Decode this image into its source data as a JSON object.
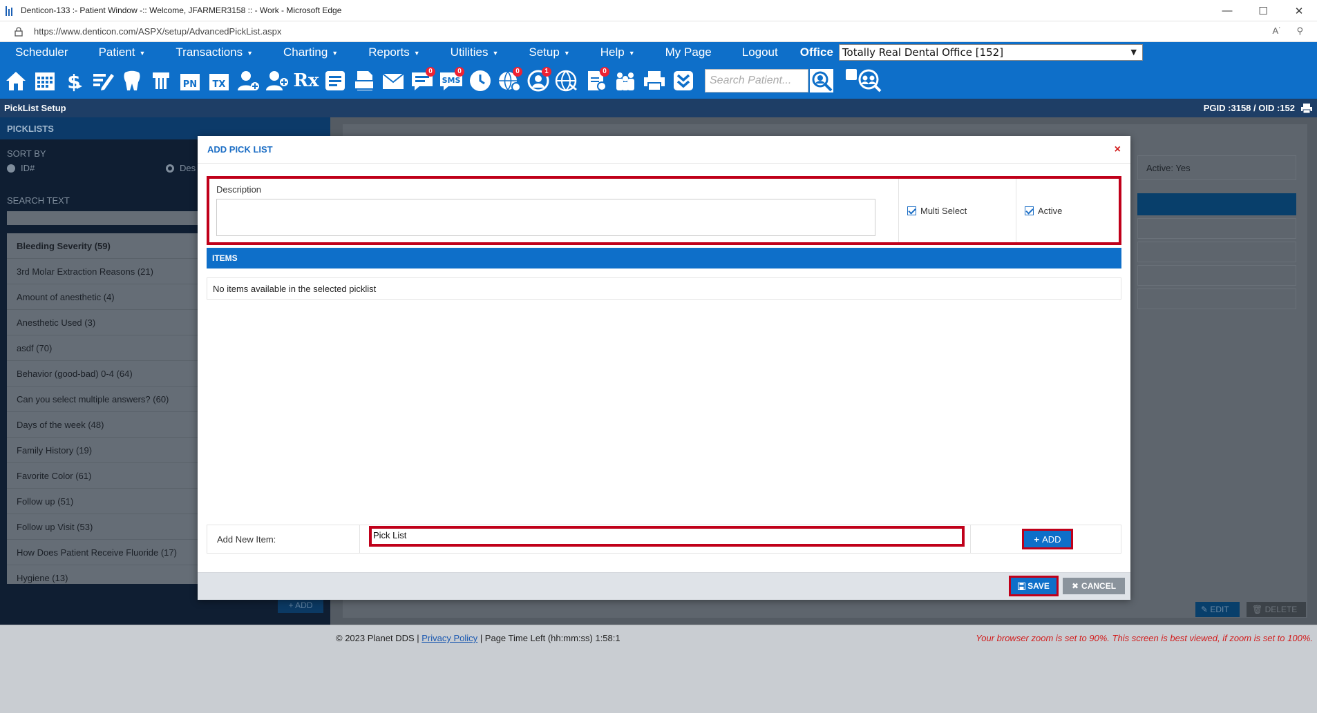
{
  "window": {
    "title": "Denticon-133 :- Patient Window -:: Welcome, JFARMER3158 :: - Work - Microsoft Edge",
    "url": "https://www.denticon.com/ASPX/setup/AdvancedPickList.aspx"
  },
  "menu": {
    "items": [
      {
        "label": "Scheduler",
        "caret": false
      },
      {
        "label": "Patient",
        "caret": true
      },
      {
        "label": "Transactions",
        "caret": true
      },
      {
        "label": "Charting",
        "caret": true
      },
      {
        "label": "Reports",
        "caret": true
      },
      {
        "label": "Utilities",
        "caret": true
      },
      {
        "label": "Setup",
        "caret": true
      },
      {
        "label": "Help",
        "caret": true
      },
      {
        "label": "My Page",
        "caret": false
      },
      {
        "label": "Logout",
        "caret": false
      }
    ],
    "office_label": "Office",
    "office_value": "Totally Real Dental Office [152]"
  },
  "toolbar": {
    "search_placeholder": "Search Patient...",
    "badges": {
      "chat": "0",
      "sms": "0",
      "globe": "0",
      "alert": "1",
      "docs": "0"
    },
    "text_icons": {
      "pn": "PN",
      "tx": "TX",
      "rx": "Rx",
      "sms": "SMS"
    }
  },
  "page_header": {
    "title": "PickList Setup",
    "ids": "PGID :3158  /  OID :152"
  },
  "left_panel": {
    "header": "PICKLISTS",
    "sort_by": "SORT BY",
    "sort_id": "ID#",
    "sort_desc": "Des",
    "search_label": "SEARCH TEXT",
    "add_label": "+ ADD",
    "items": [
      "Bleeding Severity (59)",
      "3rd Molar Extraction Reasons (21)",
      "Amount of anesthetic (4)",
      "Anesthetic Used (3)",
      "asdf (70)",
      "Behavior (good-bad) 0-4 (64)",
      "Can you select multiple answers? (60)",
      "Days of the week (48)",
      "Family History (19)",
      "Favorite Color (61)",
      "Follow up (51)",
      "Follow up Visit (53)",
      "How Does Patient Receive Fluoride (17)",
      "Hygiene (13)"
    ]
  },
  "right_panel": {
    "active_text": "Active: Yes",
    "edit_label": "EDIT",
    "delete_label": "DELETE"
  },
  "modal": {
    "title": "ADD PICK LIST",
    "close": "×",
    "description_label": "Description",
    "description_value": "",
    "multi_select_label": "Multi Select",
    "multi_select_checked": true,
    "active_label": "Active",
    "active_checked": true,
    "items_header": "ITEMS",
    "items_empty": "No items available in the selected picklist",
    "add_new_label": "Add New Item:",
    "add_new_value": "Pick List",
    "add_button": "ADD",
    "save_button": "SAVE",
    "cancel_button": "CANCEL"
  },
  "footer": {
    "copyright": "© 2023 Planet DDS |",
    "privacy": "Privacy Policy",
    "time_left": "| Page Time Left (hh:mm:ss) 1:58:1",
    "zoom_warning": "Your browser zoom is set to 90%. This screen is best viewed, if zoom is set to 100%."
  },
  "colors": {
    "brand_blue": "#0e6fc9",
    "header_navy": "#1e3e66",
    "highlight_red": "#c0001a"
  }
}
